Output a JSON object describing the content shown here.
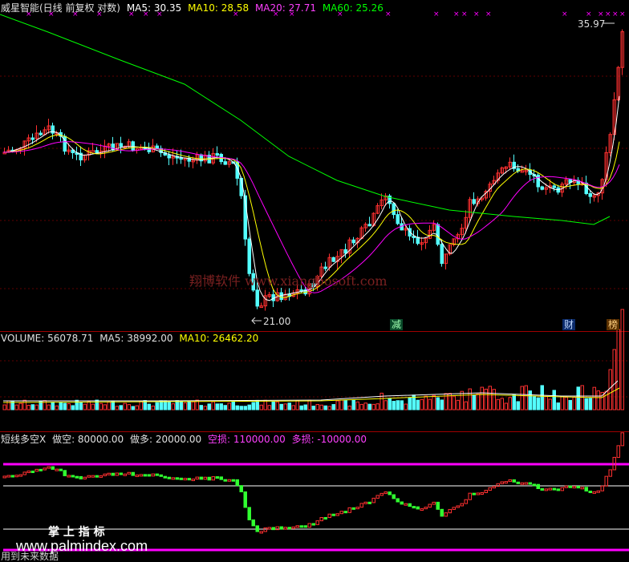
{
  "main_header": {
    "title": "威星智能(日线 前复权 对数)",
    "ma5": "MA5: 30.35",
    "ma10": "MA10: 28.58",
    "ma20": "MA20: 27.71",
    "ma60": "MA60: 25.26"
  },
  "price_high_label": "35.97",
  "price_low_label": "21.00",
  "watermark": "翔博软件 www.xiangbosoft.com",
  "event_badges": [
    "减",
    "财",
    "榜"
  ],
  "volume_header": {
    "volume": "VOLUME: 56078.71",
    "ma5": "MA5: 38992.00",
    "ma10": "MA10: 26462.20"
  },
  "indicator_header": {
    "name": "短线多空X",
    "short": "做空: 80000.00",
    "long": "做多: 20000.00",
    "empty_loss": "空损: 110000.00",
    "long_loss": "多损: -10000.00"
  },
  "footer": {
    "site_cn": "掌 上 指 标",
    "site_url": "www.palmindex.com",
    "warning": "用到未来数据"
  },
  "colors": {
    "up": "#ff3030",
    "down": "#54ffff",
    "ma5": "#ffffff",
    "ma10": "#ffff00",
    "ma20": "#ff00ff",
    "ma60": "#00ff00",
    "grid": "#a00000",
    "marker": "#ff00ff"
  }
}
